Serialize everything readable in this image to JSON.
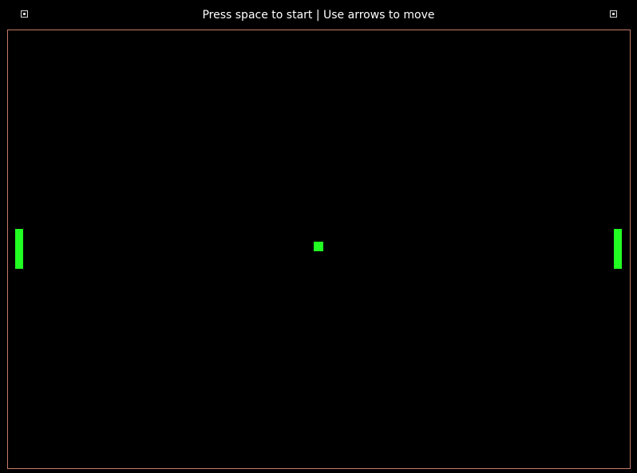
{
  "header": {
    "status_text": "Press space to start | Use arrows to move"
  },
  "colors": {
    "background": "#000000",
    "paddle": "#22ff22",
    "ball": "#22ff22",
    "court_border": "#c77a6a",
    "text": "#ffffff"
  },
  "icons": {
    "left_score": "square-dot-icon",
    "right_score": "square-dot-icon"
  }
}
